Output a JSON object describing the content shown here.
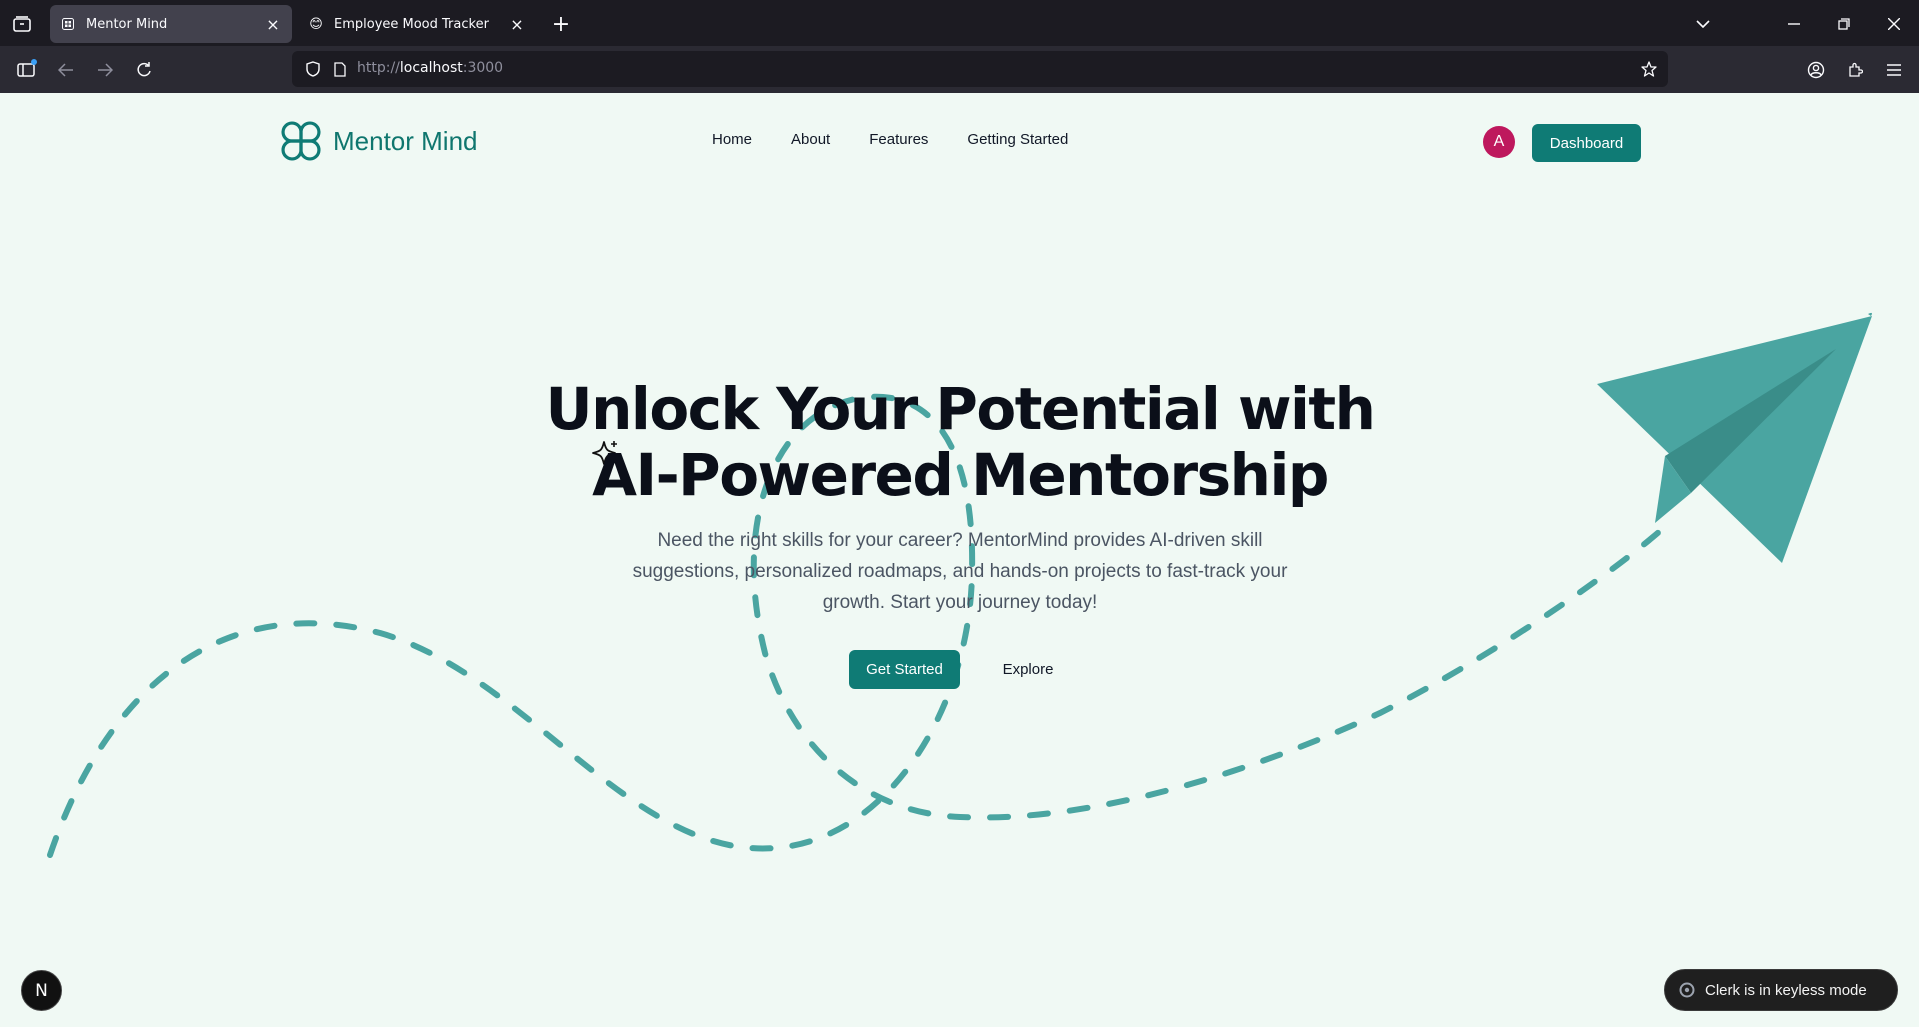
{
  "browser": {
    "tabs": [
      {
        "title": "Mentor Mind",
        "active": true
      },
      {
        "title": "Employee Mood Tracker",
        "active": false,
        "favicon": "😊"
      }
    ],
    "url": {
      "scheme": "http://",
      "host": "localhost",
      "port": ":3000"
    }
  },
  "header": {
    "brand": "Mentor Mind",
    "nav": [
      "Home",
      "About",
      "Features",
      "Getting Started"
    ],
    "avatar_initial": "A",
    "dashboard_label": "Dashboard"
  },
  "hero": {
    "title_line1": "Unlock Your Potential with",
    "title_line2": "AI-Powered Mentorship",
    "subtitle": "Need the right skills for your career? MentorMind provides AI-driven skill suggestions, personalized roadmaps, and hands-on projects to fast-track your growth. Start your journey today!",
    "primary_cta": "Get Started",
    "secondary_cta": "Explore"
  },
  "overlays": {
    "next_badge": "N",
    "clerk_toast": "Clerk is in keyless mode"
  },
  "colors": {
    "brand": "#0f7b75",
    "plane": "#4aa5a1",
    "page_bg": "#f0f9f4",
    "avatar": "#be185d"
  }
}
